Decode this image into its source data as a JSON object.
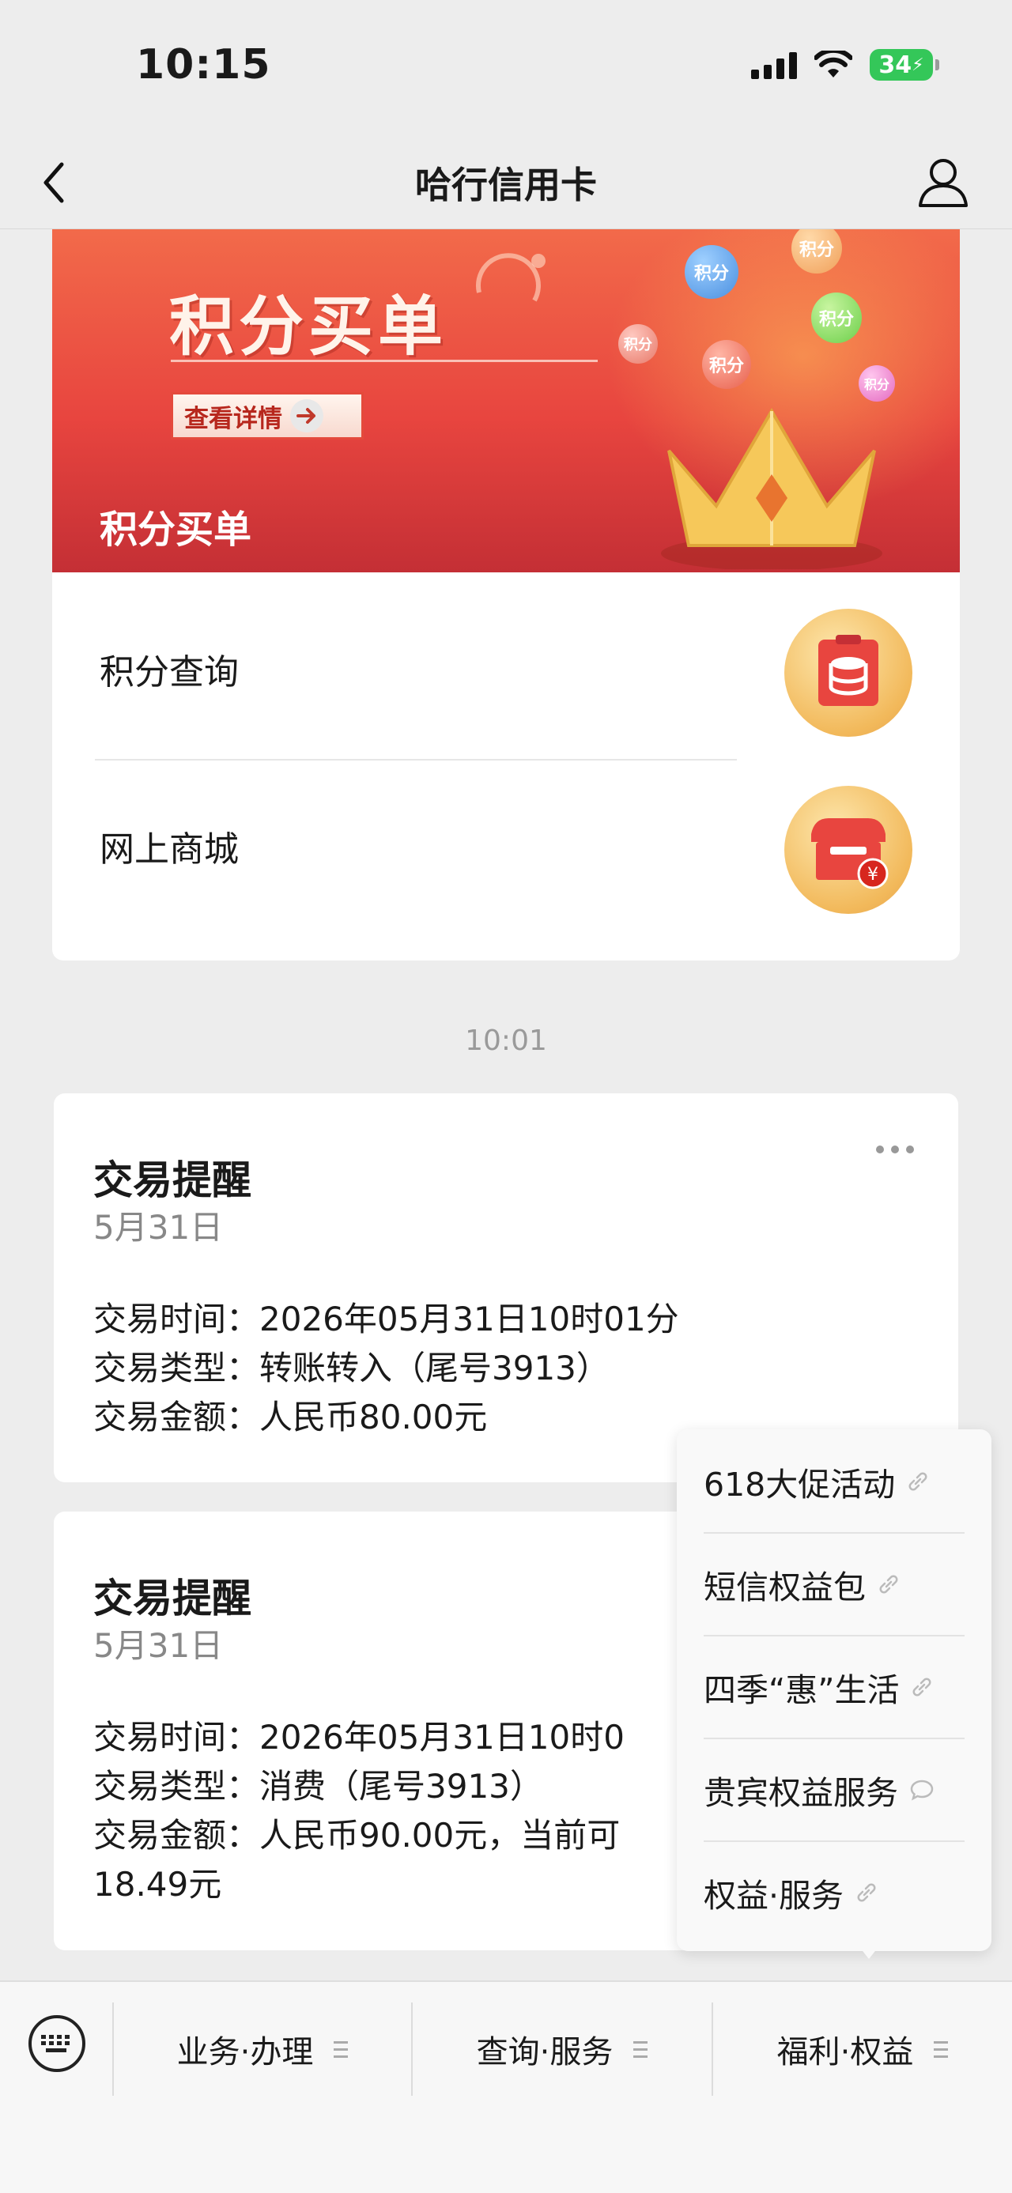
{
  "status_bar": {
    "time": "10:15",
    "battery": "34"
  },
  "nav": {
    "title": "哈行信用卡"
  },
  "promo": {
    "banner_title": "积分买单",
    "banner_cta": "查看详情",
    "banner_caption": "积分买单",
    "bubble_text": "积分",
    "menu": [
      {
        "label": "积分查询"
      },
      {
        "label": "网上商城"
      }
    ]
  },
  "timestamp": "10:01",
  "transactions": [
    {
      "title": "交易提醒",
      "date": "5月31日",
      "lines": [
        "交易时间：2026年05月31日10时01分",
        "交易类型：转账转入（尾号3913）",
        "交易金额：人民币80.00元"
      ]
    },
    {
      "title": "交易提醒",
      "date": "5月31日",
      "lines": [
        "交易时间：2026年05月31日10时0",
        "交易类型：消费（尾号3913）",
        "交易金额：人民币90.00元，当前可",
        "18.49元"
      ]
    }
  ],
  "popup_menu": [
    {
      "label": "618大促活动",
      "icon": "link-icon"
    },
    {
      "label": "短信权益包",
      "icon": "link-icon"
    },
    {
      "label": "四季“惠”生活",
      "icon": "link-icon"
    },
    {
      "label": "贵宾权益服务",
      "icon": "chat-bubble-icon"
    },
    {
      "label": "权益·服务",
      "icon": "link-icon"
    }
  ],
  "bottom_menu": [
    {
      "label": "业务·办理"
    },
    {
      "label": "查询·服务"
    },
    {
      "label": "福利·权益"
    }
  ]
}
